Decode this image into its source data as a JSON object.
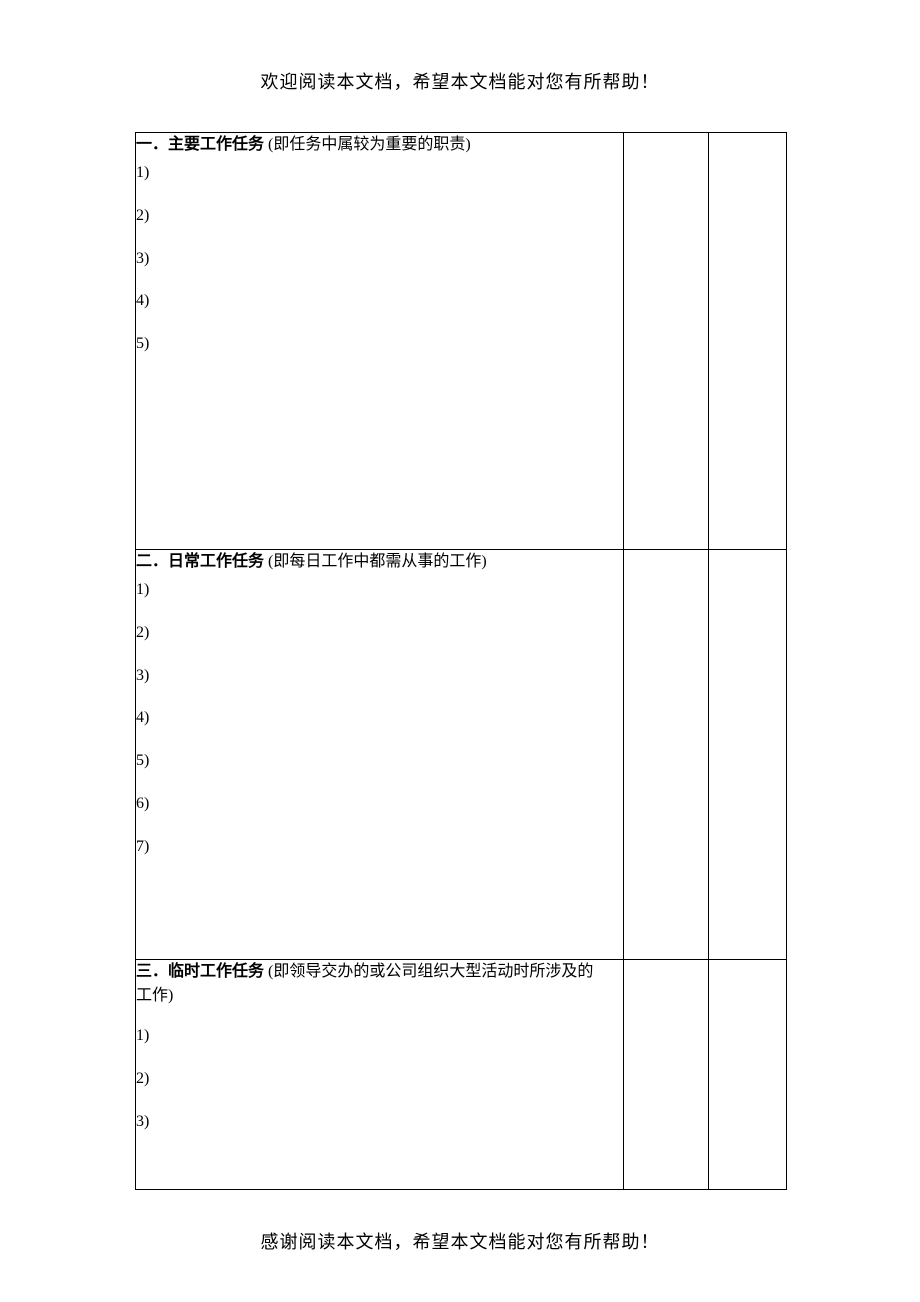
{
  "header": {
    "text": "欢迎阅读本文档，希望本文档能对您有所帮助！"
  },
  "footer": {
    "text": "感谢阅读本文档，希望本文档能对您有所帮助！"
  },
  "sections": [
    {
      "title_strong": "一．主要工作任务",
      "desc": "(即任务中属较为重要的职责)",
      "desc_wrap": "",
      "items": [
        "1)",
        "2)",
        "3)",
        "4)",
        "5)"
      ]
    },
    {
      "title_strong": "二．日常工作任务",
      "desc": "(即每日工作中都需从事的工作)",
      "desc_wrap": "",
      "items": [
        "1)",
        "2)",
        "3)",
        "4)",
        "5)",
        "6)",
        "7)"
      ]
    },
    {
      "title_strong": "三．临时工作任务",
      "desc": "(即领导交办的或公司组织大型活动时所涉及的",
      "desc_wrap": "工作)",
      "items": [
        "1)",
        "2)",
        "3)"
      ]
    }
  ]
}
